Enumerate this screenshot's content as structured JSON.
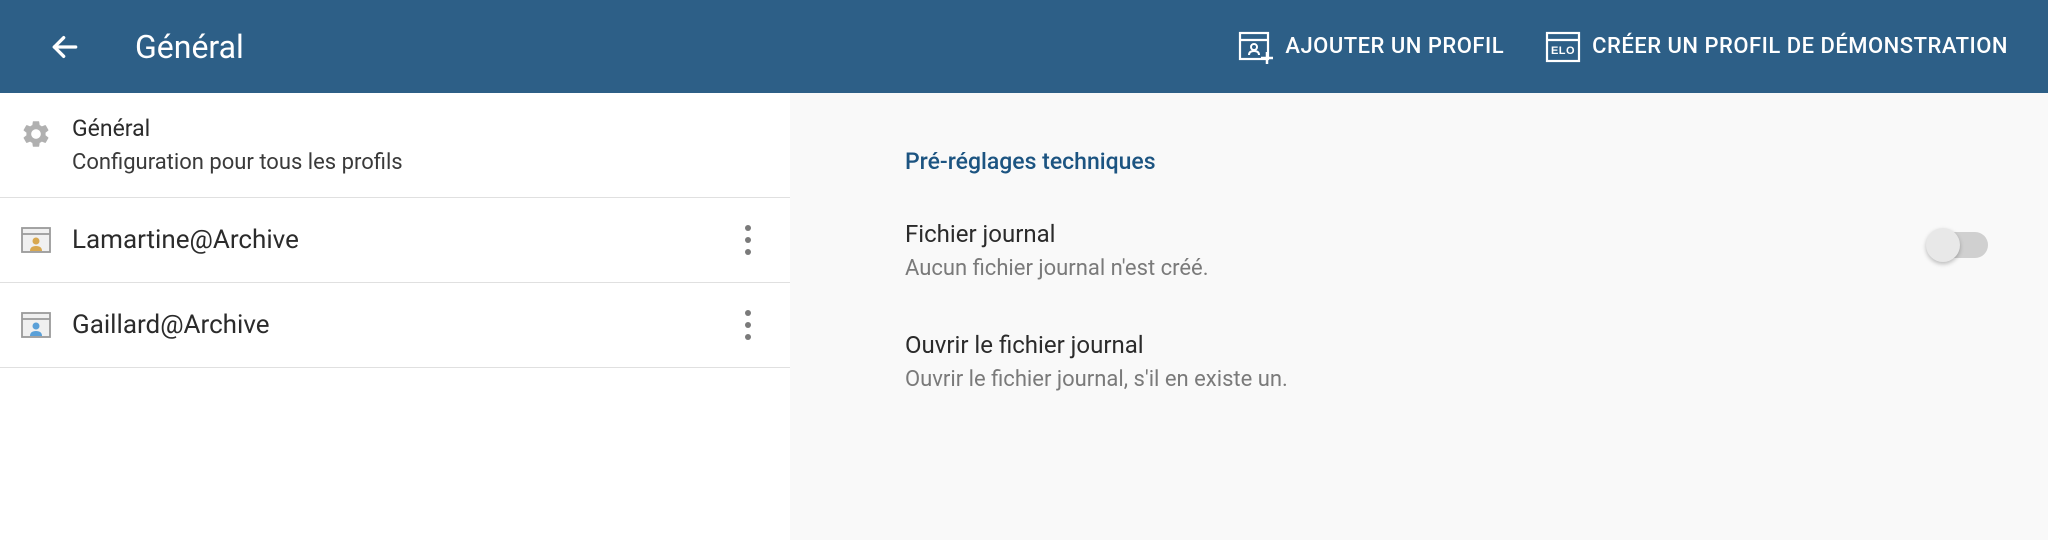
{
  "header": {
    "title": "Général",
    "actions": {
      "addProfile": "AJOUTER UN PROFIL",
      "createDemoProfile": "CRÉER UN PROFIL DE DÉMONSTRATION"
    }
  },
  "leftPanel": {
    "general": {
      "title": "Général",
      "subtitle": "Configuration pour tous les profils"
    },
    "profiles": [
      {
        "name": "Lamartine@Archive",
        "iconColor": "#d8a850"
      },
      {
        "name": "Gaillard@Archive",
        "iconColor": "#5aa0d8"
      }
    ]
  },
  "rightPanel": {
    "sectionHeading": "Pré-réglages techniques",
    "settings": [
      {
        "title": "Fichier journal",
        "subtitle": "Aucun fichier journal n'est créé.",
        "hasToggle": true
      },
      {
        "title": "Ouvrir le fichier journal",
        "subtitle": "Ouvrir le fichier journal, s'il en existe un.",
        "hasToggle": false
      }
    ]
  }
}
